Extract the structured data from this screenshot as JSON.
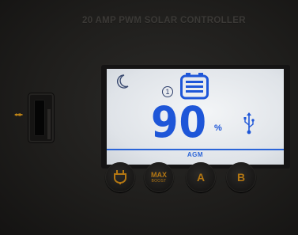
{
  "device": {
    "product_title": "20 AMP PWM SOLAR CONTROLLER"
  },
  "lcd": {
    "status_number": "①",
    "reading_value": "90",
    "reading_unit": "%",
    "battery_type_label": "AGM",
    "icons": [
      "moon-icon",
      "battery-icon",
      "usb-icon"
    ],
    "text_color": "#1e56d8",
    "backlight_color": "#e6eaee"
  },
  "usb_port": {
    "indicator_icon": "usb-symbol"
  },
  "buttons": {
    "power_icon": "power-plug-icon",
    "max_label": "MAX",
    "max_sub_label": "BOOST",
    "a_label": "A",
    "b_label": "B",
    "accent_color": "#b47712"
  }
}
